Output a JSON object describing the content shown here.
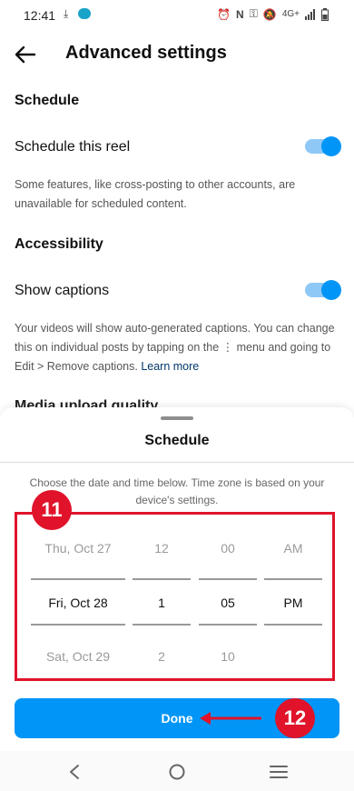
{
  "status_bar": {
    "time": "12:41",
    "network": "4G+"
  },
  "header": {
    "title": "Advanced settings"
  },
  "schedule_section": {
    "title": "Schedule",
    "toggle_label": "Schedule this reel",
    "toggle_on": true,
    "description": "Some features, like cross-posting to other accounts, are unavailable for scheduled content."
  },
  "accessibility_section": {
    "title": "Accessibility",
    "toggle_label": "Show captions",
    "toggle_on": true,
    "description_part1": "Your videos will show auto-generated captions. You can change this on individual posts by tapping on the ⋮ menu and going to Edit > Remove captions.",
    "learn_more": "Learn more"
  },
  "partial_section_title": "Media upload quality",
  "sheet": {
    "title": "Schedule",
    "description": "Choose the date and time below. Time zone is based on your device's settings.",
    "picker": {
      "date": {
        "prev": "Thu, Oct 27",
        "selected": "Fri, Oct 28",
        "next": "Sat, Oct 29"
      },
      "hour": {
        "prev": "12",
        "selected": "1",
        "next": "2"
      },
      "minute": {
        "prev": "00",
        "selected": "05",
        "next": "10"
      },
      "ampm": {
        "prev": "AM",
        "selected": "PM",
        "next": ""
      }
    },
    "done_label": "Done"
  },
  "annotations": {
    "badge_11": "11",
    "badge_12": "12",
    "highlight_color": "#e0132a"
  },
  "colors": {
    "accent": "#0095f6",
    "toggle_track": "#8ec8f6"
  }
}
